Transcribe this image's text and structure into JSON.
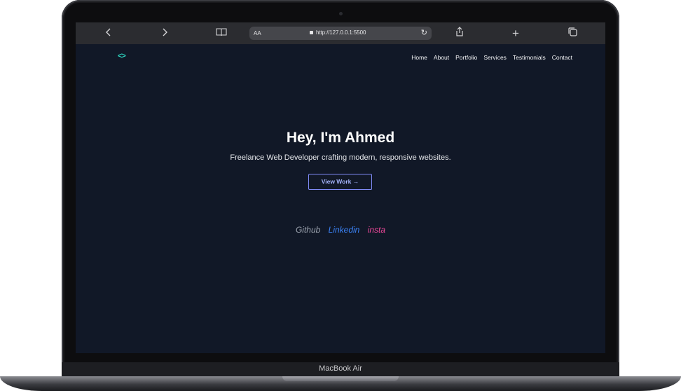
{
  "device": {
    "label": "MacBook Air"
  },
  "browser": {
    "back_icon": "chevron-left-icon",
    "forward_icon": "chevron-right-icon",
    "reader_icon": "book-icon",
    "text_size_label": "AA",
    "url": "http://127.0.0.1:5500",
    "reload_icon": "reload-icon",
    "share_icon": "share-icon",
    "new_tab_icon": "plus-icon",
    "tabs_icon": "tabs-icon"
  },
  "site": {
    "logo": "<>",
    "nav": [
      "Home",
      "About",
      "Portfolio",
      "Services",
      "Testimonials",
      "Contact"
    ],
    "hero": {
      "title": "Hey, I'm Ahmed",
      "subtitle": "Freelance Web Developer crafting modern, responsive websites.",
      "cta_label": "View Work →"
    },
    "socials": [
      {
        "label": "Github",
        "color": "#9ca3af"
      },
      {
        "label": "Linkedin",
        "color": "#3b82f6"
      },
      {
        "label": "insta",
        "color": "#ec4899"
      }
    ]
  },
  "colors": {
    "page_background": "#111827",
    "accent_logo": "#2dd4bf",
    "cta_border": "#818cf8"
  }
}
